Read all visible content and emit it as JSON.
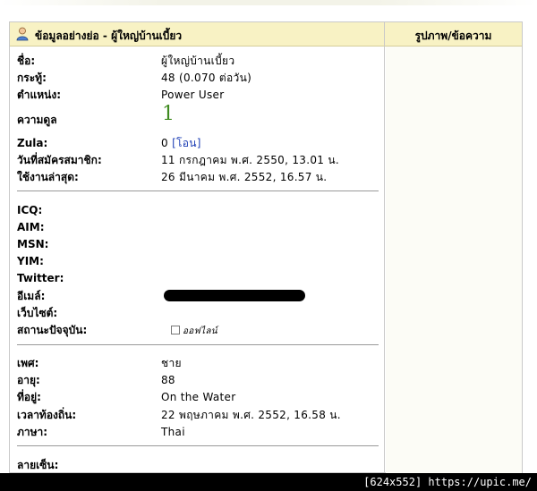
{
  "header": {
    "left_title": "ข้อมูลอย่างย่อ - ผู้ใหญ่บ้านเบี้ยว",
    "right_title": "รูปภาพ/ข้อความ"
  },
  "profile": {
    "name_label": "ชื่อ:",
    "name_value": "ผู้ใหญ่บ้านเบี้ยว",
    "posts_label": "กระทู้:",
    "posts_value": "48 (0.070 ต่อวัน)",
    "position_label": "ตำแหน่ง:",
    "position_value": "Power User",
    "reputation_label": "ความดูล",
    "reputation_value": "1",
    "zula_label": "Zula:",
    "zula_value": "0",
    "zula_link": "[โอน]",
    "joined_label": "วันที่สมัครสมาชิก:",
    "joined_value": "11 กรกฎาคม พ.ศ. 2550, 13.01 น.",
    "last_active_label": "ใช้งานล่าสุด:",
    "last_active_value": "26 มีนาคม พ.ศ. 2552, 16.57 น."
  },
  "contact": {
    "icq_label": "ICQ:",
    "aim_label": "AIM:",
    "msn_label": "MSN:",
    "yim_label": "YIM:",
    "twitter_label": "Twitter:",
    "email_label": "อีเมล์:",
    "website_label": "เว็บไซต์:",
    "status_label": "สถานะปัจจุบัน:",
    "status_value": "ออฟไลน์"
  },
  "personal": {
    "gender_label": "เพศ:",
    "gender_value": "ชาย",
    "age_label": "อายุ:",
    "age_value": "88",
    "location_label": "ที่อยู่:",
    "location_value": "On the Water",
    "localtime_label": "เวลาท้องถิ่น:",
    "localtime_value": "22 พฤษภาคม พ.ศ. 2552, 16.58 น.",
    "language_label": "ภาษา:",
    "language_value": "Thai"
  },
  "signature": {
    "label": "ลายเซ็น:"
  },
  "footer": {
    "text": "[624x552] https://upic.me/"
  },
  "colors": {
    "header_bg": "#f8f2c4",
    "reputation": "#3f8a1f",
    "link": "#1e3fb5"
  }
}
